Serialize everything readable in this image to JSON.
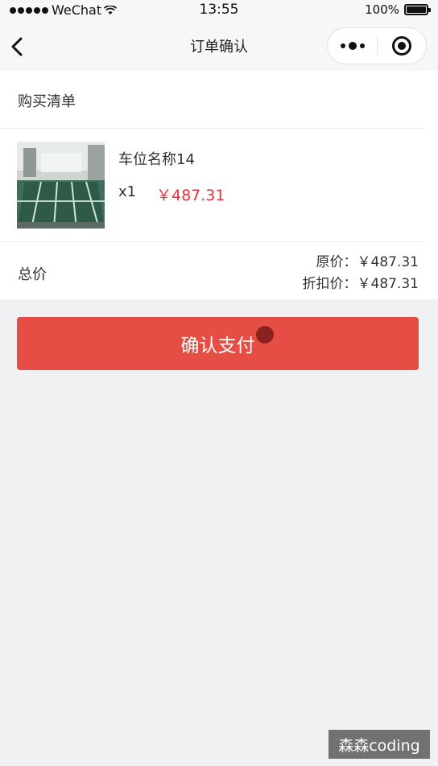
{
  "status_bar": {
    "carrier": "WeChat",
    "time": "13:55",
    "battery": "100%"
  },
  "nav": {
    "title": "订单确认"
  },
  "order": {
    "section_title": "购买清单",
    "item": {
      "name": "车位名称14",
      "quantity": "x1",
      "price": "￥487.31"
    },
    "total_label": "总价",
    "original_price": "原价：￥487.31",
    "discount_price": "折扣价：￥487.31"
  },
  "pay_button_label": "确认支付",
  "watermark": "森森coding",
  "colors": {
    "accent_red": "#e64e45",
    "price_red": "#e9323c",
    "background": "#f1f1f3"
  }
}
